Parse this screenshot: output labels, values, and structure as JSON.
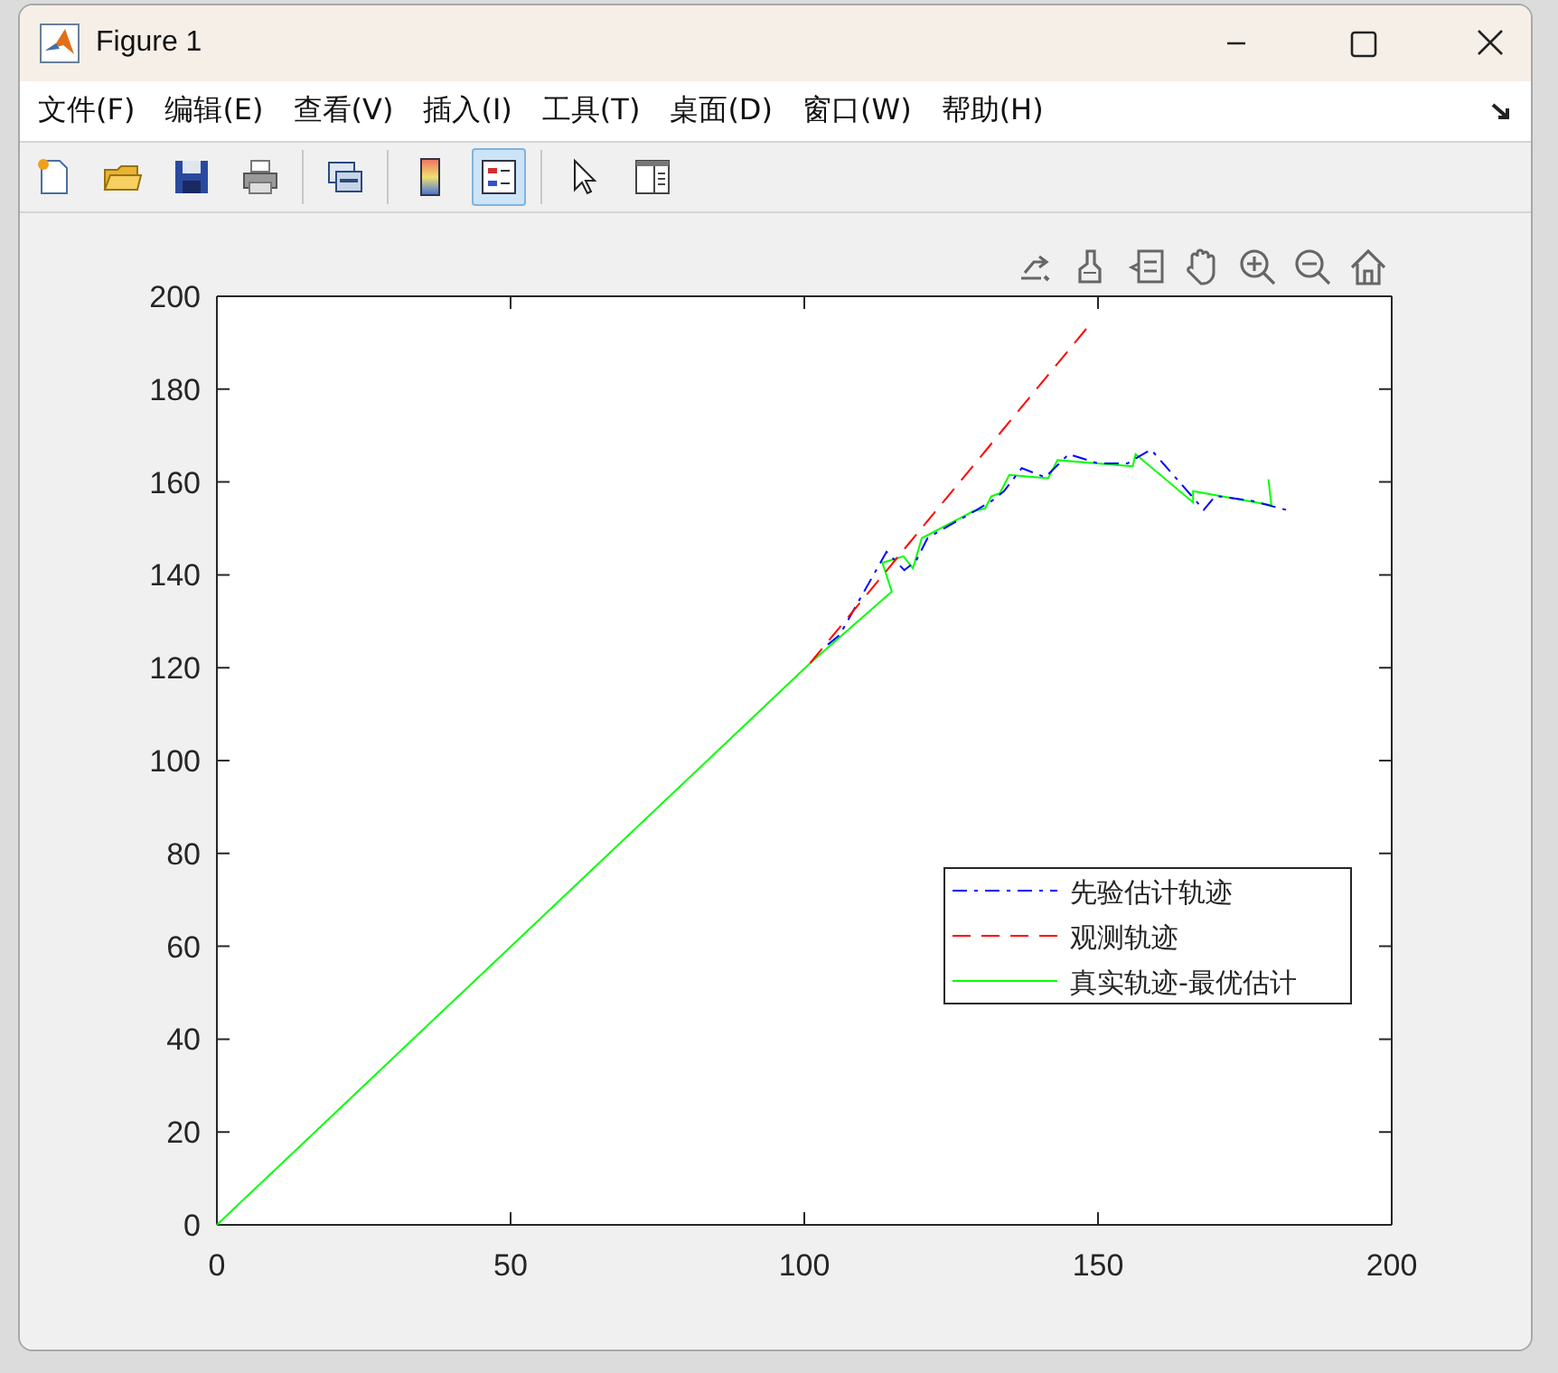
{
  "window": {
    "title": "Figure 1"
  },
  "menu": [
    "文件(F)",
    "编辑(E)",
    "查看(V)",
    "插入(I)",
    "工具(T)",
    "桌面(D)",
    "窗口(W)",
    "帮助(H)"
  ],
  "toolbar": [
    {
      "kind": "new",
      "selected": false
    },
    {
      "kind": "open",
      "selected": false
    },
    {
      "kind": "save",
      "selected": false
    },
    {
      "kind": "print",
      "selected": false
    },
    {
      "kind": "separator"
    },
    {
      "kind": "link",
      "selected": false
    },
    {
      "kind": "separator"
    },
    {
      "kind": "colorbar",
      "selected": false
    },
    {
      "kind": "legend",
      "selected": true
    },
    {
      "kind": "separator"
    },
    {
      "kind": "pointer",
      "selected": false
    },
    {
      "kind": "property",
      "selected": false
    }
  ],
  "axes_toolbar": [
    {
      "kind": "export"
    },
    {
      "kind": "brush"
    },
    {
      "kind": "datatip"
    },
    {
      "kind": "pan"
    },
    {
      "kind": "zoomin"
    },
    {
      "kind": "zoomout"
    },
    {
      "kind": "home"
    }
  ],
  "chart_data": {
    "type": "line",
    "xlim": [
      0,
      200
    ],
    "ylim": [
      0,
      200
    ],
    "xticks": [
      0,
      50,
      100,
      150,
      200
    ],
    "yticks": [
      0,
      20,
      40,
      60,
      80,
      100,
      120,
      140,
      160,
      180,
      200
    ],
    "series": [
      {
        "name": "先验估计轨迹",
        "color": "#0000ff",
        "line_style": "dashdot",
        "x": [
          104,
          106,
          114,
          117,
          119,
          121,
          128,
          132,
          134,
          137,
          141,
          145,
          150,
          155,
          159,
          168,
          170,
          176,
          182
        ],
        "values": [
          125,
          127,
          145,
          141,
          143,
          148,
          153,
          156,
          158,
          163,
          161,
          166,
          164,
          164,
          167,
          154,
          157,
          156,
          154
        ]
      },
      {
        "name": "观测轨迹",
        "color": "#ff0000",
        "line_style": "dashed",
        "x": [
          101,
          148
        ],
        "values": [
          121,
          193
        ]
      },
      {
        "name": "真实轨迹-最优估计",
        "color": "#00ff00",
        "line_style": "solid",
        "x": [
          0,
          101,
          114.9,
          113.3,
          116.9,
          118.5,
          120,
          127.7,
          128.7,
          130.8,
          131.8,
          133.3,
          134.9,
          141.5,
          143.1,
          155.9,
          156.4,
          166.2,
          166.2,
          179.5,
          179
        ],
        "values": [
          0,
          121,
          136.4,
          142.6,
          144,
          141.4,
          147.9,
          153,
          153.7,
          154.3,
          156.9,
          157.6,
          161.5,
          160.8,
          164.7,
          163.4,
          166,
          155.6,
          158,
          155,
          160.6
        ]
      }
    ],
    "legend": true
  }
}
